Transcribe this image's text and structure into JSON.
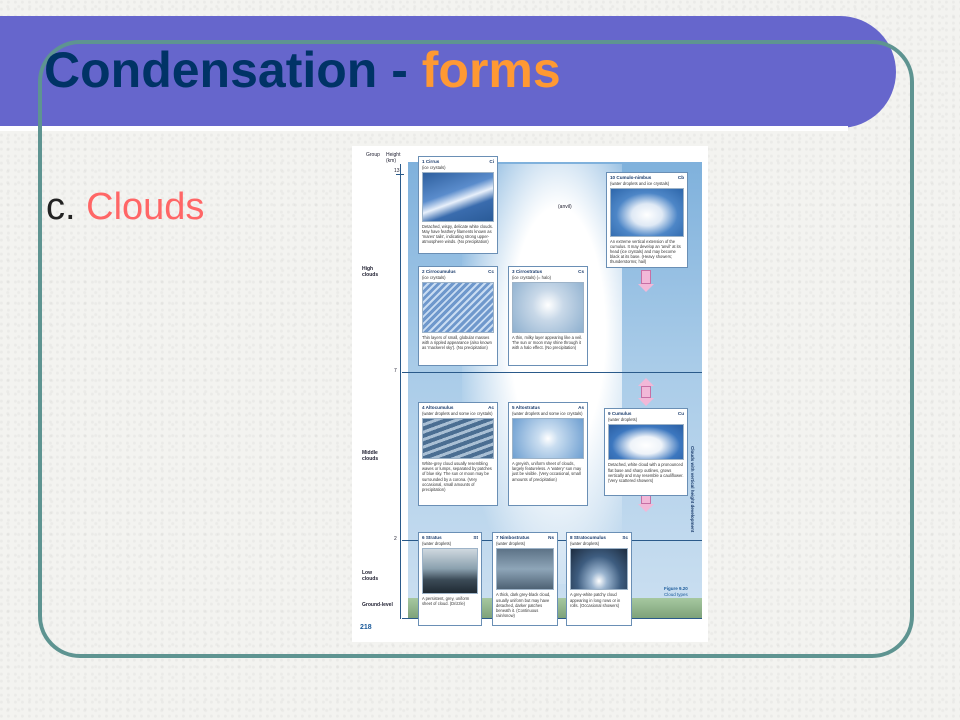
{
  "slide": {
    "title_main": "Condensation - ",
    "title_accent": "forms",
    "bullet_prefix": "c. ",
    "bullet_accent": "Clouds"
  },
  "figure": {
    "col_group": "Group",
    "col_height": "Height\n(km)",
    "tick_13": "13",
    "tick_7": "7",
    "tick_2": "2",
    "group_high": "High\nclouds",
    "group_middle": "Middle\nclouds",
    "group_low": "Low\nclouds",
    "ground_level": "Ground-level",
    "anvil": "(anvil)",
    "vertical_label": "Clouds with vertical height development",
    "page_number": "218",
    "figure_number": "Figure 9.20",
    "figure_title": "Cloud types",
    "cards": {
      "cirrus": {
        "title": "1 Cirrus",
        "sub": "(ice crystals)",
        "code": "Ci",
        "desc": "Detached, wispy, delicate white clouds. May have feathery filaments known as 'mares' tails', indicating strong upper-atmosphere winds. (No precipitation)"
      },
      "cirrocumulus": {
        "title": "2 Cirrocumulus",
        "sub": "(ice crystals)",
        "code": "Cc",
        "desc": "Thin layers of small, globular masses with a rippled appearance (also known as 'mackerel sky'). (No precipitation)"
      },
      "cirrostratus": {
        "title": "3 Cirrostratus",
        "sub": "(ice crystals) (= halo)",
        "code": "Cs",
        "desc": "A thin, milky layer appearing like a veil. The sun or moon may shine through it with a halo effect. (No precipitation)"
      },
      "cumulonimbus": {
        "title": "10 Cumulo-nimbus",
        "sub": "(water droplets and ice crystals)",
        "code": "Cb",
        "desc": "An extreme vertical extension of the cumulus. It may develop an 'anvil' at its head (ice crystals) and may become black at its base. (Heavy showers; thunderstorms; hail)"
      },
      "altocumulus": {
        "title": "4 Altocumulus",
        "sub": "(water droplets and some ice crystals)",
        "code": "Ac",
        "desc": "White-grey cloud usually resembling waves or lumps, separated by patches of blue sky. The sun or moon may be surrounded by a corona. (Very occasional, small amounts of precipitation)"
      },
      "altostratus": {
        "title": "5 Altostratus",
        "sub": "(water droplets and some ice crystals)",
        "code": "As",
        "desc": "A greyish, uniform sheet of clouds, largely featureless. A 'watery' sun may just be visible. (Very occasional, small amounts of precipitation)"
      },
      "cumulus": {
        "title": "9 Cumulus",
        "sub": "(water droplets)",
        "code": "Cu",
        "desc": "Detached, white cloud with a pronounced flat base and sharp outlines, grows vertically and may resemble a cauliflower. (Very scattered showers)"
      },
      "stratus": {
        "title": "6 Stratus",
        "sub": "(water droplets)",
        "code": "St",
        "desc": "A persistent, grey, uniform sheet of cloud. (Drizzle)"
      },
      "nimbostratus": {
        "title": "7 Nimbostratus",
        "sub": "(water droplets)",
        "code": "Ns",
        "desc": "A thick, dark grey-black cloud, usually uniform but may have detached, darker patches beneath it. (Continuous rain/snow)"
      },
      "stratocumulus": {
        "title": "8 Stratocumulus",
        "sub": "(water droplets)",
        "code": "Sc",
        "desc": "A grey-white patchy cloud appearing in long rows or in rolls. (Occasional showers)"
      }
    }
  }
}
